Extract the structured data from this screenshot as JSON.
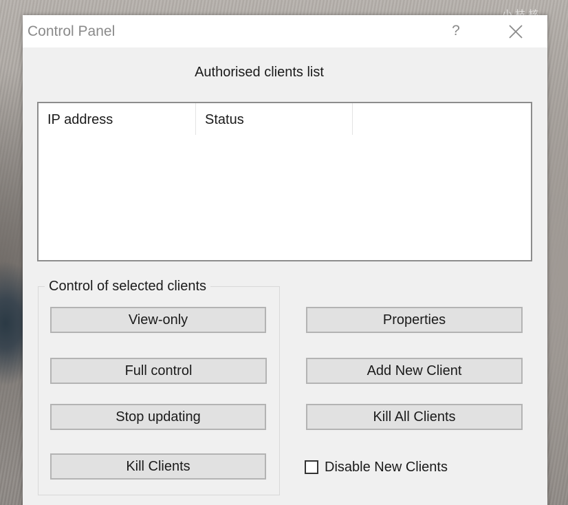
{
  "window": {
    "title": "Control Panel",
    "help_label": "?"
  },
  "background": {
    "corner_text": "小 枝 核"
  },
  "clients": {
    "heading": "Authorised clients list",
    "columns": [
      "IP address",
      "Status",
      ""
    ],
    "rows": []
  },
  "control_group": {
    "legend": "Control of selected clients",
    "view_only": "View-only",
    "full_control": "Full control",
    "stop_updating": "Stop updating",
    "kill_clients": "Kill Clients"
  },
  "actions": {
    "properties": "Properties",
    "add_new_client": "Add New Client",
    "kill_all_clients": "Kill All Clients"
  },
  "options": {
    "disable_new_clients_label": "Disable New Clients",
    "disable_new_clients_checked": false
  },
  "colors": {
    "dialog_bg": "#f0f0f0",
    "button_bg": "#e1e1e1",
    "title_text": "#8a8a8a"
  }
}
